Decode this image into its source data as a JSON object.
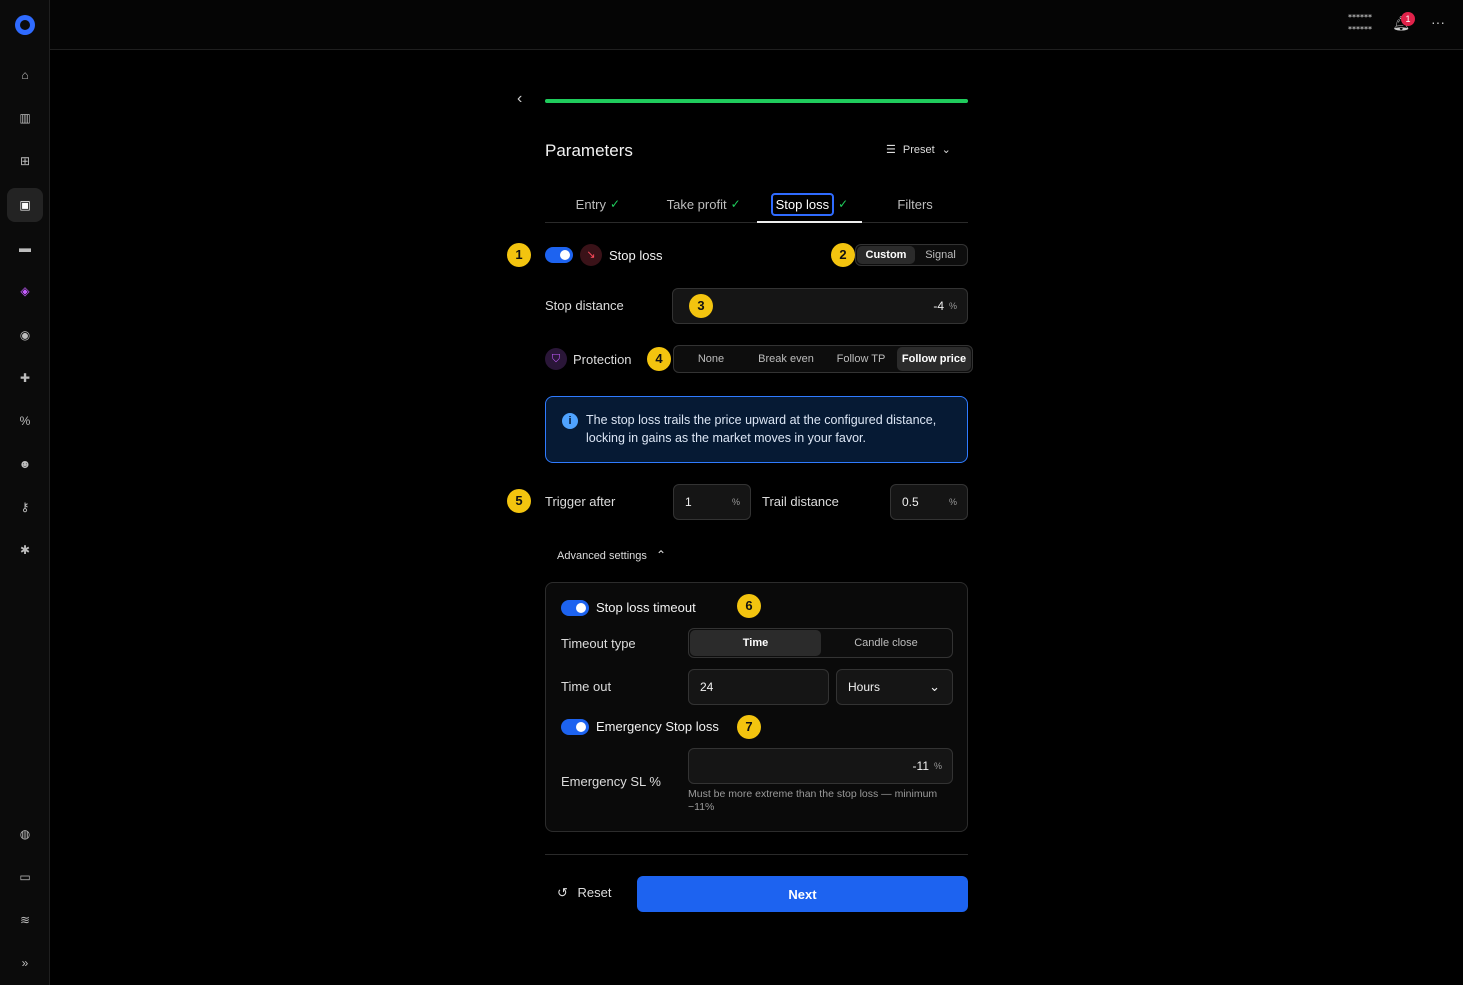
{
  "sidebar": {
    "icons": [
      "home-icon",
      "chart-icon",
      "grid-icon",
      "bot-icon",
      "wallet-icon",
      "tag-icon",
      "compass-icon",
      "puzzle-icon",
      "percent-icon",
      "user-icon",
      "key-icon",
      "gear-icon",
      "chat-icon",
      "monitor-icon",
      "wifi-icon",
      "expand-icon"
    ],
    "glyphs": {
      "home": "⌂",
      "chart": "▥",
      "grid": "⊞",
      "bot": "▣",
      "wallet": "▬",
      "tag": "◈",
      "compass": "◉",
      "puzzle": "✚",
      "percent": "%",
      "user": "☻",
      "key": "⚷",
      "gear": "✱",
      "chat": "◍",
      "monitor": "▭",
      "wifi": "≋",
      "expand": "»"
    }
  },
  "topbar": {
    "user_line1": "******",
    "user_line2": "******",
    "notification_count": "1",
    "more": "···"
  },
  "header": {
    "back": "‹",
    "title": "Parameters",
    "preset_label": "Preset",
    "progress": 1.0,
    "preset_icon": "☰",
    "chevron": "⌄"
  },
  "tabs": [
    {
      "label": "Entry",
      "check": "✓"
    },
    {
      "label": "Take profit",
      "check": "✓"
    },
    {
      "label": "Stop loss",
      "check": "✓"
    },
    {
      "label": "Filters",
      "check": ""
    }
  ],
  "markers": [
    "1",
    "2",
    "3",
    "4",
    "5",
    "6",
    "7"
  ],
  "stop_loss": {
    "label": "Stop loss",
    "enabled": true,
    "icon": "↘",
    "mode_options": [
      "Custom",
      "Signal"
    ],
    "mode_selected": "Custom",
    "distance_label": "Stop distance",
    "distance_value": "-4",
    "distance_unit": "%"
  },
  "protection": {
    "label": "Protection",
    "icon": "⛉",
    "options": [
      "None",
      "Break even",
      "Follow TP",
      "Follow price"
    ],
    "selected": "Follow price",
    "info_icon": "i",
    "info": "The stop loss trails the price upward at the configured distance, locking in gains as the market moves in your favor."
  },
  "trailing": {
    "trigger_label": "Trigger after",
    "trigger_value": "1",
    "trigger_unit": "%",
    "trail_label": "Trail distance",
    "trail_value": "0.5",
    "trail_unit": "%"
  },
  "advanced": {
    "label": "Advanced settings",
    "chevron": "⌃",
    "timeout": {
      "label": "Stop loss timeout",
      "enabled": true,
      "type_label": "Timeout type",
      "type_options": [
        "Time",
        "Candle close"
      ],
      "type_selected": "Time",
      "time_label": "Time out",
      "time_value": "24",
      "unit_value": "Hours",
      "unit_chevron": "⌄"
    },
    "emergency": {
      "label": "Emergency Stop loss",
      "enabled": true,
      "field_label": "Emergency SL %",
      "value": "-11",
      "unit": "%",
      "hint": "Must be more extreme than the stop loss — minimum −11%"
    }
  },
  "footer": {
    "reset_icon": "↺",
    "reset_label": "Reset",
    "next_label": "Next"
  },
  "colors": {
    "accent": "#1d63f0",
    "success": "#1fcb5c",
    "marker": "#f3c40f",
    "danger": "#e0224a"
  }
}
